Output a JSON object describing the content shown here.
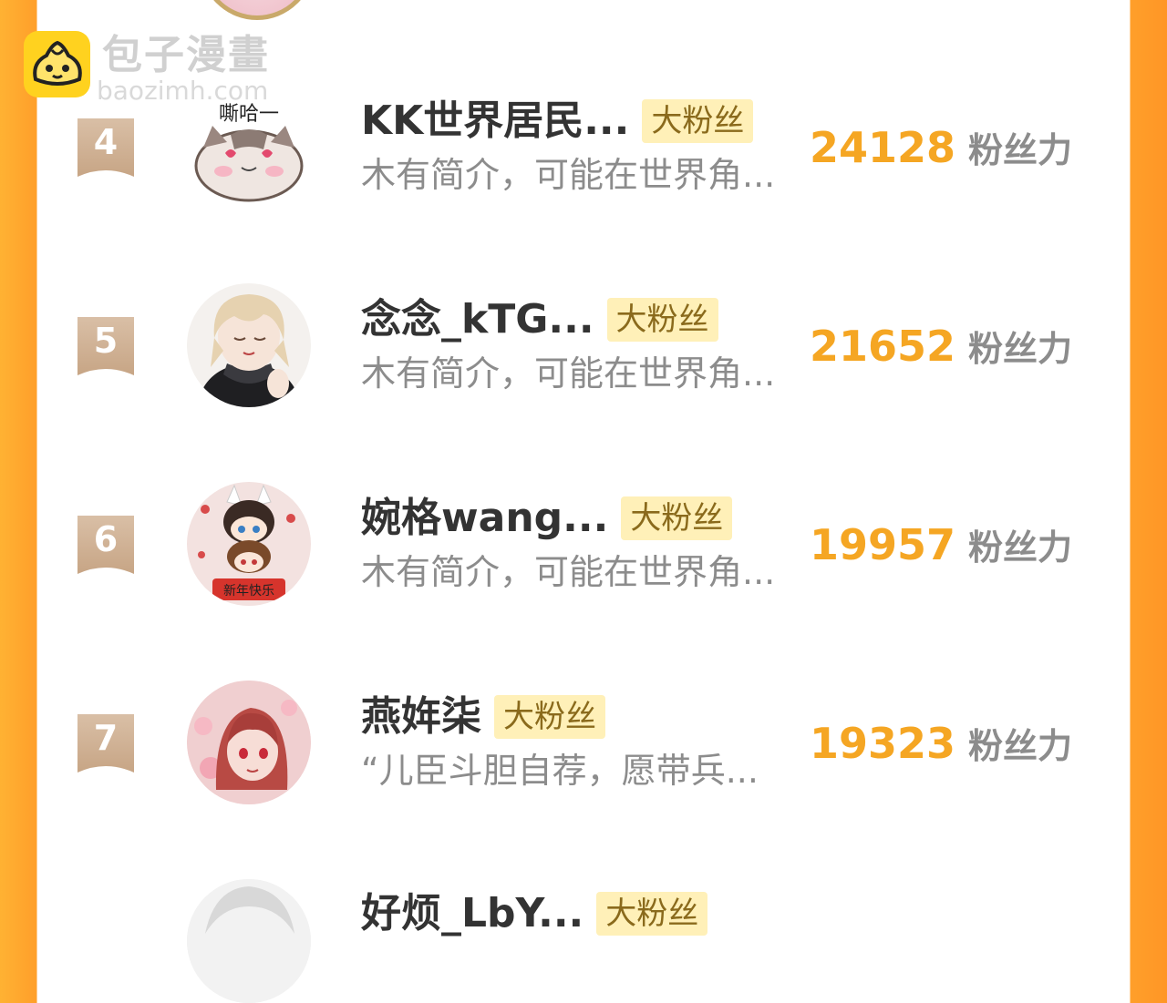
{
  "watermark": {
    "title": "包子漫畫",
    "url": "baozimh.com"
  },
  "list": [
    {
      "rank": "4",
      "name": "KK世界居民...",
      "badge": "大粉丝",
      "intro": "木有简介，可能在世界角...",
      "score": "24128",
      "unit": "粉丝力",
      "avatar_text": "嘶哈一"
    },
    {
      "rank": "5",
      "name": "念念_kTG...",
      "badge": "大粉丝",
      "intro": "木有简介，可能在世界角...",
      "score": "21652",
      "unit": "粉丝力"
    },
    {
      "rank": "6",
      "name": "婉格wang...",
      "badge": "大粉丝",
      "intro": "木有简介，可能在世界角...",
      "score": "19957",
      "unit": "粉丝力",
      "avatar_text": "新年快乐"
    },
    {
      "rank": "7",
      "name": "燕姩柒",
      "badge": "大粉丝",
      "intro": "“儿臣斗胆自荐，愿带兵...",
      "score": "19323",
      "unit": "粉丝力"
    },
    {
      "name": "好烦_LbY...",
      "badge": "大粉丝"
    }
  ]
}
